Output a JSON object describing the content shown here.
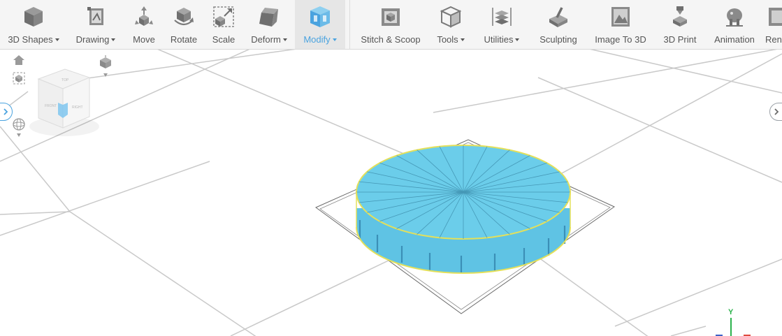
{
  "toolbar": {
    "items": [
      {
        "label": "3D Shapes",
        "has_menu": true,
        "icon": "cube-icon"
      },
      {
        "label": "Drawing",
        "has_menu": true,
        "icon": "drawing-icon"
      },
      {
        "label": "Move",
        "has_menu": false,
        "icon": "move-icon"
      },
      {
        "label": "Rotate",
        "has_menu": false,
        "icon": "rotate-icon"
      },
      {
        "label": "Scale",
        "has_menu": false,
        "icon": "scale-icon"
      },
      {
        "label": "Deform",
        "has_menu": true,
        "icon": "deform-icon"
      },
      {
        "label": "Modify",
        "has_menu": true,
        "icon": "modify-icon",
        "active": true
      },
      {
        "label": "Stitch & Scoop",
        "has_menu": false,
        "icon": "stitch-scoop-icon"
      },
      {
        "label": "Tools",
        "has_menu": true,
        "icon": "tools-icon"
      },
      {
        "label": "Utilities",
        "has_menu": true,
        "icon": "utilities-icon"
      },
      {
        "label": "Sculpting",
        "has_menu": false,
        "icon": "sculpting-icon"
      },
      {
        "label": "Image To 3D",
        "has_menu": false,
        "icon": "image-to-3d-icon"
      },
      {
        "label": "3D Print",
        "has_menu": false,
        "icon": "3d-print-icon"
      },
      {
        "label": "Animation",
        "has_menu": false,
        "icon": "animation-icon"
      },
      {
        "label": "Rende",
        "has_menu": false,
        "icon": "render-icon"
      }
    ]
  },
  "viewcube": {
    "faces": {
      "top": "TOP",
      "front": "FRONT",
      "right": "RIGHT"
    }
  },
  "axes": {
    "y": "Y"
  },
  "colors": {
    "accent": "#4aa3df",
    "object_fill": "#6bcdea",
    "object_side": "#5bb8dc",
    "selection_outline": "#e4e05a",
    "grid": "#c8c8c8",
    "axis_y": "#2bb24c",
    "axis_x": "#e04a3f",
    "axis_z": "#3d62c7"
  }
}
